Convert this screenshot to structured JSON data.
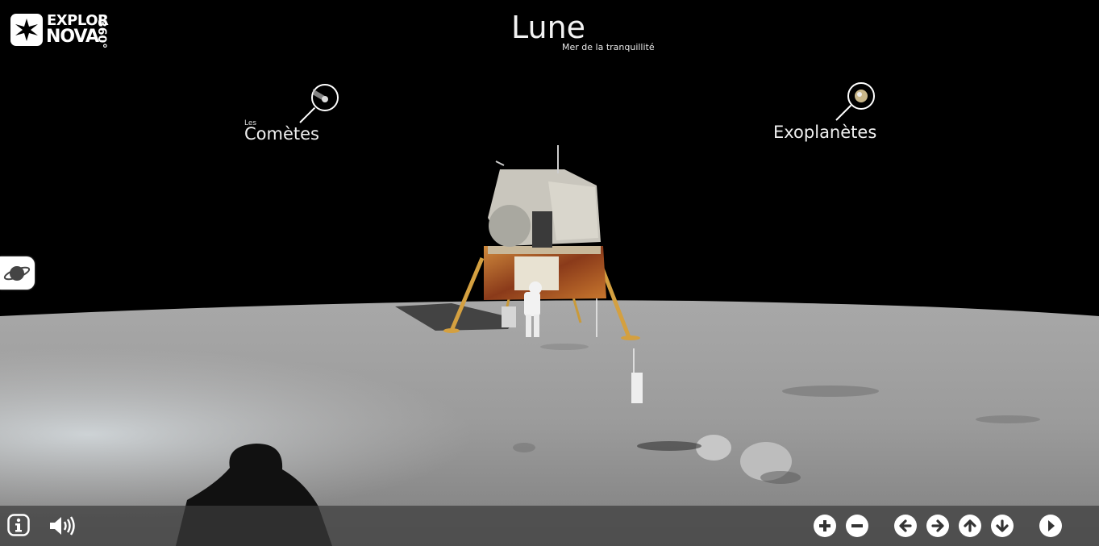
{
  "brand": {
    "logo_line1": "EXPLOR",
    "logo_line2": "NOVA",
    "logo_suffix": "360°"
  },
  "header": {
    "title": "Lune",
    "subtitle": "Mer de la tranquillité"
  },
  "hotspots": [
    {
      "small": "Les",
      "label": "Comètes",
      "icon": "comet-icon"
    },
    {
      "small": "",
      "label": "Exoplanètes",
      "icon": "planet-icon"
    }
  ],
  "side_button": {
    "icon": "saturn-icon"
  },
  "toolbar": {
    "left": [
      "info-icon",
      "volume-icon"
    ],
    "right": [
      "zoom-in-icon",
      "zoom-out-icon",
      "arrow-left-icon",
      "arrow-right-icon",
      "arrow-up-icon",
      "arrow-down-icon",
      "play-icon"
    ]
  },
  "colors": {
    "toolbar_bg": "#3c3c3c",
    "sky": "#000000",
    "ground": "#9a9a9a",
    "lander_gold": "#b06a2c"
  }
}
